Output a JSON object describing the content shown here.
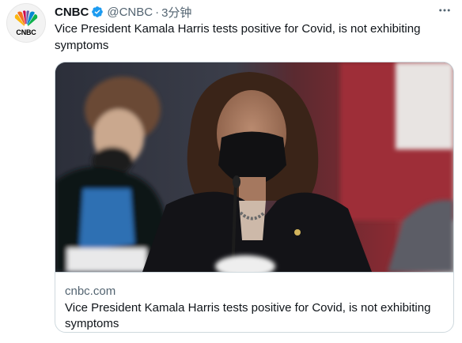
{
  "tweet": {
    "author_name": "CNBC",
    "handle": "@CNBC",
    "separator": "·",
    "time": "3分钟",
    "text": "Vice President Kamala Harris tests positive for Covid, is not exhibiting symptoms",
    "more_icon": "more-dots-icon",
    "verified_icon": "verified-badge-icon"
  },
  "avatar": {
    "logo_text": "CNBC",
    "peacock_colors": [
      "#fcb711",
      "#f37021",
      "#cc004c",
      "#6460aa",
      "#0089d0",
      "#0db14b"
    ]
  },
  "card": {
    "domain": "cnbc.com",
    "title": "Vice President Kamala Harris tests positive for Covid, is not exhibiting symptoms"
  },
  "colors": {
    "text": "#0f1419",
    "secondary": "#536471",
    "border": "#cfd9de",
    "verified": "#1d9bf0"
  }
}
